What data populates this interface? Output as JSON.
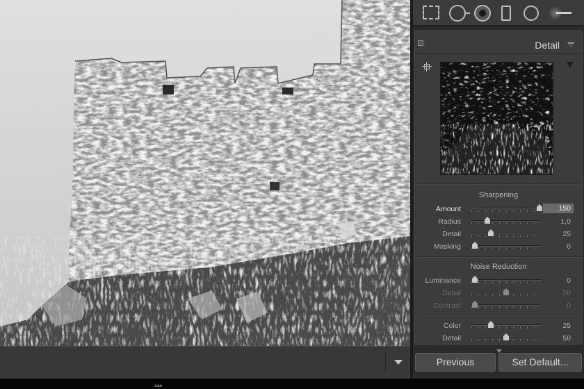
{
  "panel": {
    "title": "Detail",
    "sharpening": {
      "title": "Sharpening",
      "sliders": [
        {
          "label": "Amount",
          "value": "150",
          "fraction": 0.98,
          "active": true,
          "dim": false
        },
        {
          "label": "Radius",
          "value": "1,0",
          "fraction": 0.23,
          "active": false,
          "dim": false
        },
        {
          "label": "Detail",
          "value": "25",
          "fraction": 0.28,
          "active": false,
          "dim": false
        },
        {
          "label": "Masking",
          "value": "0",
          "fraction": 0.05,
          "active": false,
          "dim": false
        }
      ]
    },
    "noise_reduction": {
      "title": "Noise Reduction",
      "sliders": [
        {
          "label": "Luminance",
          "value": "0",
          "fraction": 0.05,
          "active": false,
          "dim": false
        },
        {
          "label": "Detail",
          "value": "50",
          "fraction": 0.5,
          "active": false,
          "dim": true
        },
        {
          "label": "Contrast",
          "value": "0",
          "fraction": 0.05,
          "active": false,
          "dim": true
        },
        {
          "label": "Color",
          "value": "25",
          "fraction": 0.28,
          "active": false,
          "dim": false
        },
        {
          "label": "Detail",
          "value": "50",
          "fraction": 0.5,
          "active": false,
          "dim": false
        }
      ]
    }
  },
  "buttons": {
    "previous": "Previous",
    "set_default": "Set Default..."
  },
  "tools": [
    "crop-overlay-icon",
    "spot-removal-icon",
    "red-eye-icon",
    "graduated-filter-icon",
    "radial-filter-icon",
    "adjustment-brush-icon"
  ]
}
